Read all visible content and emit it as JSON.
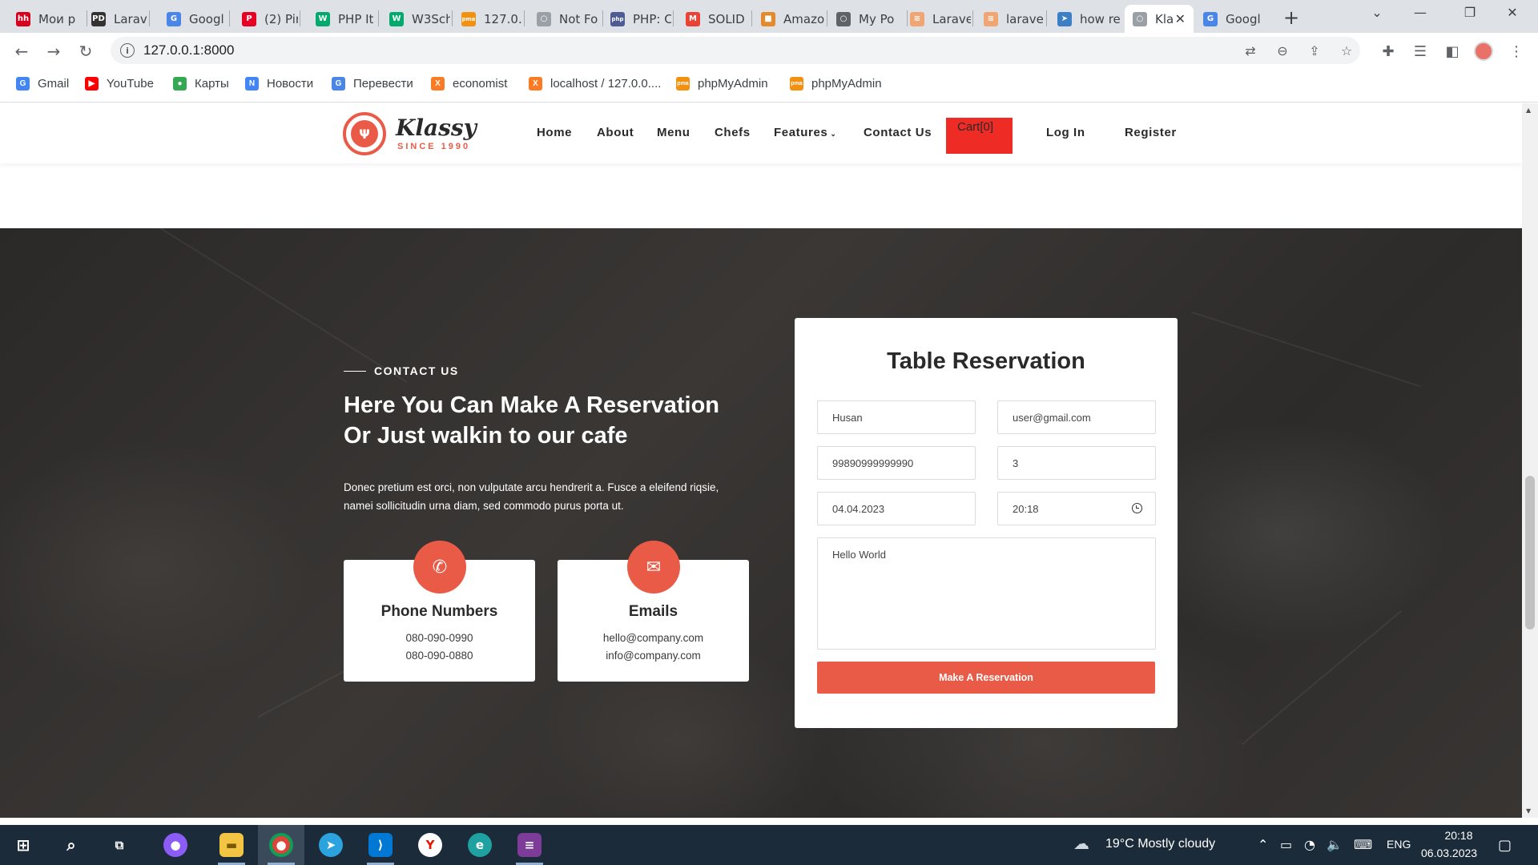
{
  "browser": {
    "tabs": [
      {
        "title": "Мои p",
        "favicon": "hh-icon",
        "color": "#d6001c",
        "glyph": "hh"
      },
      {
        "title": "Larave",
        "favicon": "pd-icon",
        "color": "#333333",
        "glyph": "PD"
      },
      {
        "title": "Googl",
        "favicon": "google-translate-icon",
        "color": "#4a86e8",
        "glyph": "G"
      },
      {
        "title": "(2) Pin",
        "favicon": "pinterest-icon",
        "color": "#e60023",
        "glyph": "P"
      },
      {
        "title": "PHP It",
        "favicon": "w3-icon",
        "color": "#04aa6d",
        "glyph": "W"
      },
      {
        "title": "W3Sch",
        "favicon": "w3-icon",
        "color": "#04aa6d",
        "glyph": "W"
      },
      {
        "title": "127.0.",
        "favicon": "phpmyadmin-icon",
        "color": "#f29111",
        "glyph": "pma"
      },
      {
        "title": "Not Fo",
        "favicon": "globe-icon",
        "color": "#9aa0a6",
        "glyph": "○"
      },
      {
        "title": "PHP: C",
        "favicon": "php-icon",
        "color": "#4f5b93",
        "glyph": "php"
      },
      {
        "title": "SOLID",
        "favicon": "gmail-icon",
        "color": "#ea4335",
        "glyph": "M"
      },
      {
        "title": "Amazo",
        "favicon": "box-icon",
        "color": "#e48a2c",
        "glyph": "■"
      },
      {
        "title": "My Po",
        "favicon": "globe-icon",
        "color": "#5f6368",
        "glyph": "○"
      },
      {
        "title": "Larave",
        "favicon": "laravel-icon",
        "color": "#f0a673",
        "glyph": "≋"
      },
      {
        "title": "laravel",
        "favicon": "laravel-icon",
        "color": "#f0a673",
        "glyph": "≋"
      },
      {
        "title": "how re",
        "favicon": "send-icon",
        "color": "#3c7fc4",
        "glyph": "➤"
      },
      {
        "title": "Kla",
        "favicon": "globe-icon",
        "color": "#9aa0a6",
        "glyph": "○",
        "active": true
      },
      {
        "title": "Googl",
        "favicon": "google-translate-icon",
        "color": "#4a86e8",
        "glyph": "G"
      }
    ],
    "url": "127.0.0.1:8000",
    "bookmarks": [
      {
        "label": "Gmail",
        "favicon": "google-icon",
        "color": "#4285f4",
        "glyph": "G"
      },
      {
        "label": "YouTube",
        "favicon": "youtube-icon",
        "color": "#ff0000",
        "glyph": "▶"
      },
      {
        "label": "Карты",
        "favicon": "maps-pin-icon",
        "color": "#34a853",
        "glyph": "●"
      },
      {
        "label": "Новости",
        "favicon": "news-icon",
        "color": "#4285f4",
        "glyph": "N"
      },
      {
        "label": "Перевести",
        "favicon": "google-translate-icon",
        "color": "#4a86e8",
        "glyph": "G"
      },
      {
        "label": "economist",
        "favicon": "xampp-icon",
        "color": "#fb7a24",
        "glyph": "X"
      },
      {
        "label": "localhost / 127.0.0....",
        "favicon": "xampp-icon",
        "color": "#fb7a24",
        "glyph": "X"
      },
      {
        "label": "phpMyAdmin",
        "favicon": "phpmyadmin-icon",
        "color": "#f29111",
        "glyph": "pma"
      },
      {
        "label": "phpMyAdmin",
        "favicon": "phpmyadmin-icon",
        "color": "#f29111",
        "glyph": "pma"
      }
    ]
  },
  "site": {
    "logo": {
      "name": "Klassy",
      "tagline": "SINCE 1990"
    },
    "nav": {
      "home": "Home",
      "about": "About",
      "menu": "Menu",
      "chefs": "Chefs",
      "features": "Features",
      "contact": "Contact Us",
      "cart": "Cart[0]",
      "login": "Log In",
      "register": "Register"
    },
    "accent_color": "#ea5b47",
    "cart_color": "#ee2b24"
  },
  "contact": {
    "eyebrow": "CONTACT US",
    "heading_line1": "Here You Can Make A Reservation",
    "heading_line2": "Or Just walkin to our cafe",
    "lead": "Donec pretium est orci, non vulputate arcu hendrerit a. Fusce a eleifend riqsie, namei sollicitudin urna diam, sed commodo purus porta ut.",
    "phone": {
      "title": "Phone Numbers",
      "line1": "080-090-0990",
      "line2": "080-090-0880"
    },
    "email": {
      "title": "Emails",
      "line1": "hello@company.com",
      "line2": "info@company.com"
    }
  },
  "reservation": {
    "title": "Table Reservation",
    "name": "Husan",
    "email": "user@gmail.com",
    "phone": "99890999999990",
    "guests": "3",
    "date": "04.04.2023",
    "time": "20:18",
    "message": "Hello World",
    "submit": "Make A Reservation"
  },
  "taskbar": {
    "weather": "19°C  Mostly cloudy",
    "lang": "ENG",
    "time": "20:18",
    "date": "06.03.2023"
  }
}
